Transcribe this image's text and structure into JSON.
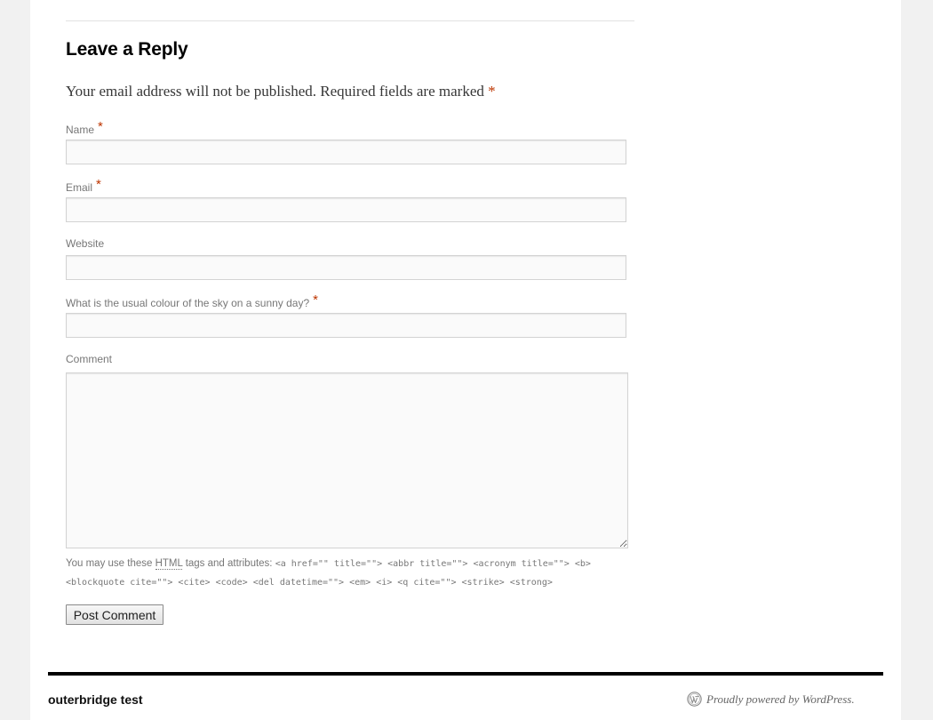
{
  "comment_form": {
    "title": "Leave a Reply",
    "notes": "Your email address will not be published. Required fields are marked",
    "required_marker": "*",
    "fields": {
      "name": {
        "label": "Name",
        "value": ""
      },
      "email": {
        "label": "Email",
        "value": ""
      },
      "website": {
        "label": "Website",
        "value": ""
      },
      "captcha": {
        "label": "What is the usual colour of the sky on a sunny day?",
        "value": ""
      },
      "comment": {
        "label": "Comment",
        "value": ""
      }
    },
    "allowed_tags": {
      "prefix": "You may use these",
      "html_abbr": "HTML",
      "suffix": "tags and attributes:",
      "tags": "<a href=\"\" title=\"\"> <abbr title=\"\"> <acronym title=\"\"> <b> <blockquote cite=\"\"> <cite> <code> <del datetime=\"\"> <em> <i> <q cite=\"\"> <strike> <strong>"
    },
    "submit_label": "Post Comment"
  },
  "footer": {
    "site_name": "outerbridge test",
    "credit": "Proudly powered by WordPress.",
    "credit_icon": "wordpress-icon"
  },
  "colors": {
    "page_background": "#f1f1f1",
    "content_background": "#ffffff",
    "required": "#bd3500",
    "footer_rule": "#000000"
  }
}
